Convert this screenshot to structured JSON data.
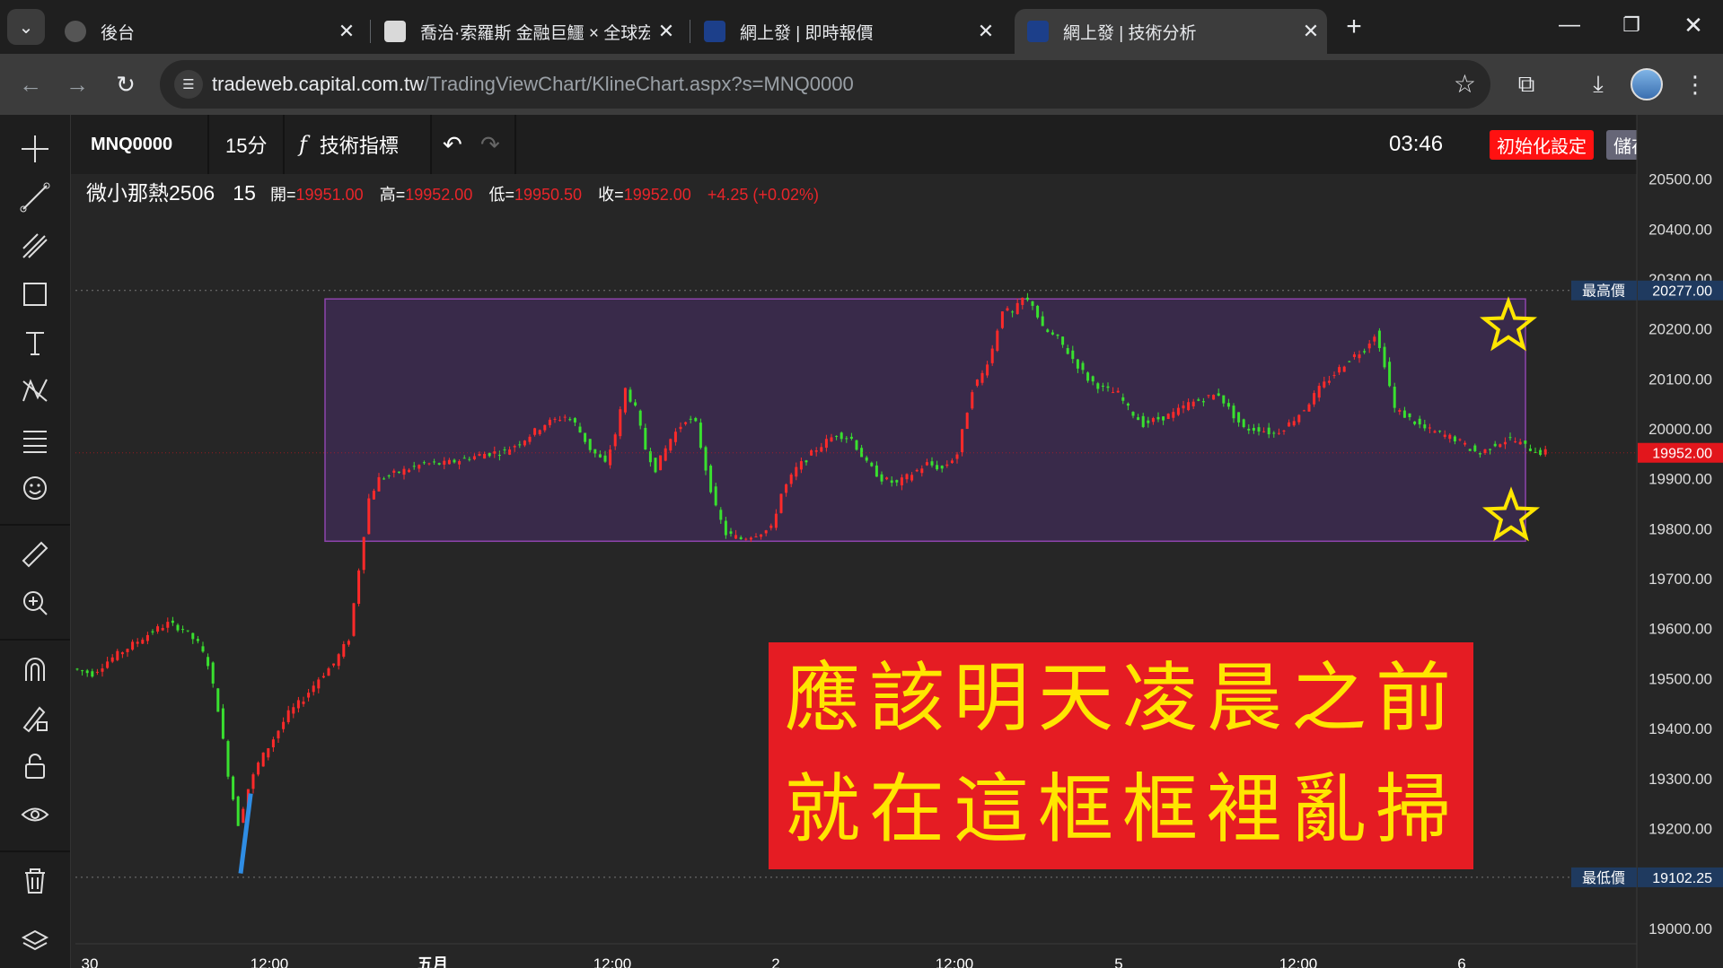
{
  "browser": {
    "tabs": [
      {
        "title": "後台",
        "active": false
      },
      {
        "title": "喬治·索羅斯 金融巨鱷 × 全球宏",
        "active": false
      },
      {
        "title": "網上發 | 即時報價",
        "active": false
      },
      {
        "title": "網上發 | 技術分析",
        "active": true
      }
    ],
    "new_tab_label": "+",
    "url_host": "tradeweb.capital.com.tw",
    "url_path": "/TradingViewChart/KlineChart.aspx?s=MNQ0000"
  },
  "toolbar": {
    "symbol": "MNQ0000",
    "interval": "15分",
    "indicators_label": "技術指標",
    "fx_symbol": "f",
    "time": "03:46",
    "reset_label": "初始化設定",
    "save_label": "儲存"
  },
  "legend": {
    "name": "微小那熱2506",
    "interval": "15",
    "open_label": "開=",
    "open": "19951.00",
    "high_label": "高=",
    "high": "19952.00",
    "low_label": "低=",
    "low": "19950.50",
    "close_label": "收=",
    "close": "19952.00",
    "change": "+4.25 (+0.02%)"
  },
  "colors": {
    "up": "#fe2a2a",
    "down": "#39e02f",
    "box_fill": "#3b2a4d",
    "box_stroke": "#8e44ad",
    "banner_bg": "#e51c23",
    "banner_text": "#ffe600",
    "price_badge": "#e2161c",
    "hl_badge": "#1f3a5f"
  },
  "chart_data": {
    "type": "candlestick",
    "y_range": [
      18980,
      20510
    ],
    "y_ticks": [
      "20500.00",
      "20400.00",
      "20300.00",
      "20200.00",
      "20100.00",
      "20000.00",
      "19900.00",
      "19800.00",
      "19700.00",
      "19600.00",
      "19500.00",
      "19400.00",
      "19300.00",
      "19200.00",
      "19100.00",
      "19000.00"
    ],
    "x_tick_labels": [
      "30",
      "12:00",
      "五月",
      "12:00",
      "2",
      "12:00",
      "5",
      "12:00",
      "6"
    ],
    "last_price": "19952.00",
    "high_label": "最高價",
    "high_value": "20277.00",
    "low_label": "最低價",
    "low_value": "19102.25",
    "box": {
      "price_top": 20260,
      "price_bottom": 19775
    },
    "path_points": [
      [
        0,
        19520
      ],
      [
        4,
        19510
      ],
      [
        7,
        19535
      ],
      [
        10,
        19555
      ],
      [
        13,
        19575
      ],
      [
        16,
        19595
      ],
      [
        19,
        19610
      ],
      [
        22,
        19600
      ],
      [
        25,
        19570
      ],
      [
        27,
        19530
      ],
      [
        29,
        19440
      ],
      [
        31,
        19310
      ],
      [
        33,
        19210
      ],
      [
        35,
        19280
      ],
      [
        37,
        19330
      ],
      [
        40,
        19380
      ],
      [
        43,
        19430
      ],
      [
        46,
        19460
      ],
      [
        49,
        19500
      ],
      [
        52,
        19530
      ],
      [
        55,
        19580
      ],
      [
        57,
        19720
      ],
      [
        59,
        19860
      ],
      [
        61,
        19900
      ],
      [
        64,
        19910
      ],
      [
        67,
        19920
      ],
      [
        70,
        19930
      ],
      [
        74,
        19930
      ],
      [
        78,
        19940
      ],
      [
        82,
        19950
      ],
      [
        86,
        19955
      ],
      [
        90,
        19980
      ],
      [
        94,
        20010
      ],
      [
        98,
        20025
      ],
      [
        100,
        20010
      ],
      [
        103,
        19960
      ],
      [
        106,
        19930
      ],
      [
        108,
        19990
      ],
      [
        110,
        20080
      ],
      [
        112,
        20040
      ],
      [
        114,
        19960
      ],
      [
        116,
        19920
      ],
      [
        119,
        19980
      ],
      [
        122,
        20020
      ],
      [
        124,
        20010
      ],
      [
        126,
        19920
      ],
      [
        128,
        19840
      ],
      [
        130,
        19790
      ],
      [
        133,
        19780
      ],
      [
        136,
        19790
      ],
      [
        139,
        19800
      ],
      [
        141,
        19870
      ],
      [
        144,
        19920
      ],
      [
        148,
        19960
      ],
      [
        152,
        19990
      ],
      [
        155,
        19980
      ],
      [
        158,
        19930
      ],
      [
        161,
        19900
      ],
      [
        164,
        19890
      ],
      [
        167,
        19910
      ],
      [
        170,
        19930
      ],
      [
        173,
        19920
      ],
      [
        176,
        19950
      ],
      [
        179,
        20080
      ],
      [
        181,
        20110
      ],
      [
        183,
        20160
      ],
      [
        185,
        20240
      ],
      [
        187,
        20230
      ],
      [
        189,
        20260
      ],
      [
        191,
        20250
      ],
      [
        193,
        20200
      ],
      [
        196,
        20180
      ],
      [
        199,
        20140
      ],
      [
        202,
        20100
      ],
      [
        205,
        20080
      ],
      [
        208,
        20070
      ],
      [
        210,
        20040
      ],
      [
        213,
        20010
      ],
      [
        216,
        20020
      ],
      [
        219,
        20030
      ],
      [
        222,
        20050
      ],
      [
        225,
        20060
      ],
      [
        228,
        20070
      ],
      [
        230,
        20040
      ],
      [
        233,
        20000
      ],
      [
        236,
        20000
      ],
      [
        239,
        19990
      ],
      [
        242,
        20010
      ],
      [
        245,
        20040
      ],
      [
        248,
        20080
      ],
      [
        251,
        20110
      ],
      [
        254,
        20140
      ],
      [
        257,
        20160
      ],
      [
        259,
        20190
      ],
      [
        261,
        20130
      ],
      [
        263,
        20040
      ],
      [
        266,
        20020
      ],
      [
        269,
        20000
      ],
      [
        272,
        19990
      ],
      [
        275,
        19980
      ],
      [
        278,
        19960
      ],
      [
        280,
        19950
      ],
      [
        283,
        19970
      ],
      [
        286,
        19980
      ],
      [
        290,
        19960
      ],
      [
        292,
        19953
      ]
    ],
    "pink_segment": [
      [
        32.5,
        19110
      ],
      [
        34.5,
        19270
      ]
    ],
    "annotation_lines": [
      "應該明天凌晨之前",
      "就在這框框裡亂掃"
    ]
  }
}
